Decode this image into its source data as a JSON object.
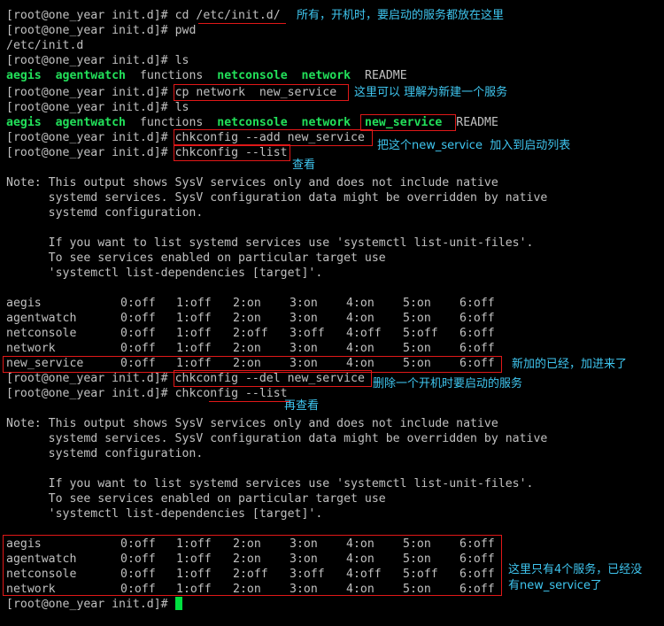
{
  "terminal": {
    "prompt": "[root@one_year init.d]# ",
    "cmd1": "cd /etc/init.d/",
    "cmd2": "pwd",
    "out_pwd": "/etc/init.d",
    "cmd3": "ls",
    "ls1": [
      "aegis",
      "agentwatch",
      "functions",
      "netconsole",
      "network",
      "README"
    ],
    "cmd4": "cp network  new_service",
    "cmd5": "ls",
    "ls2": [
      "aegis",
      "agentwatch",
      "functions",
      "netconsole",
      "network",
      "new_service",
      "README"
    ],
    "cmd6": "chkconfig --add new_service",
    "cmd7": "chkconfig --list",
    "note_lines": [
      "Note: This output shows SysV services only and does not include native",
      "      systemd services. SysV configuration data might be overridden by native",
      "      systemd configuration.",
      "",
      "      If you want to list systemd services use 'systemctl list-unit-files'.",
      "      To see services enabled on particular target use",
      "      'systemctl list-dependencies [target]'."
    ],
    "table1": [
      [
        "aegis",
        "0:off",
        "1:off",
        "2:on",
        "3:on",
        "4:on",
        "5:on",
        "6:off"
      ],
      [
        "agentwatch",
        "0:off",
        "1:off",
        "2:on",
        "3:on",
        "4:on",
        "5:on",
        "6:off"
      ],
      [
        "netconsole",
        "0:off",
        "1:off",
        "2:off",
        "3:off",
        "4:off",
        "5:off",
        "6:off"
      ],
      [
        "network",
        "0:off",
        "1:off",
        "2:on",
        "3:on",
        "4:on",
        "5:on",
        "6:off"
      ],
      [
        "new_service",
        "0:off",
        "1:off",
        "2:on",
        "3:on",
        "4:on",
        "5:on",
        "6:off"
      ]
    ],
    "cmd8": "chkconfig --del new_service",
    "cmd9": "chkconfig --list",
    "table2": [
      [
        "aegis",
        "0:off",
        "1:off",
        "2:on",
        "3:on",
        "4:on",
        "5:on",
        "6:off"
      ],
      [
        "agentwatch",
        "0:off",
        "1:off",
        "2:on",
        "3:on",
        "4:on",
        "5:on",
        "6:off"
      ],
      [
        "netconsole",
        "0:off",
        "1:off",
        "2:off",
        "3:off",
        "4:off",
        "5:off",
        "6:off"
      ],
      [
        "network",
        "0:off",
        "1:off",
        "2:on",
        "3:on",
        "4:on",
        "5:on",
        "6:off"
      ]
    ]
  },
  "annotations": {
    "a1": "所有，开机时，要启动的服务都放在这里",
    "a2": "这里可以 理解为新建一个服务",
    "a3": "把这个new_service  加入到启动列表",
    "a4": "查看",
    "a5": "新加的已经，加进来了",
    "a6": "删除一个开机时要启动的服务",
    "a7": "再查看",
    "a8_line1": "这里只有4个服务，已经没",
    "a8_line2": "有new_service了"
  },
  "colors": {
    "background": "#000000",
    "text": "#c0c0c0",
    "highlight_green": "#22e05a",
    "annotation_cyan": "#3fc6f0",
    "markup_red": "#e01818",
    "cursor": "#00e040"
  }
}
